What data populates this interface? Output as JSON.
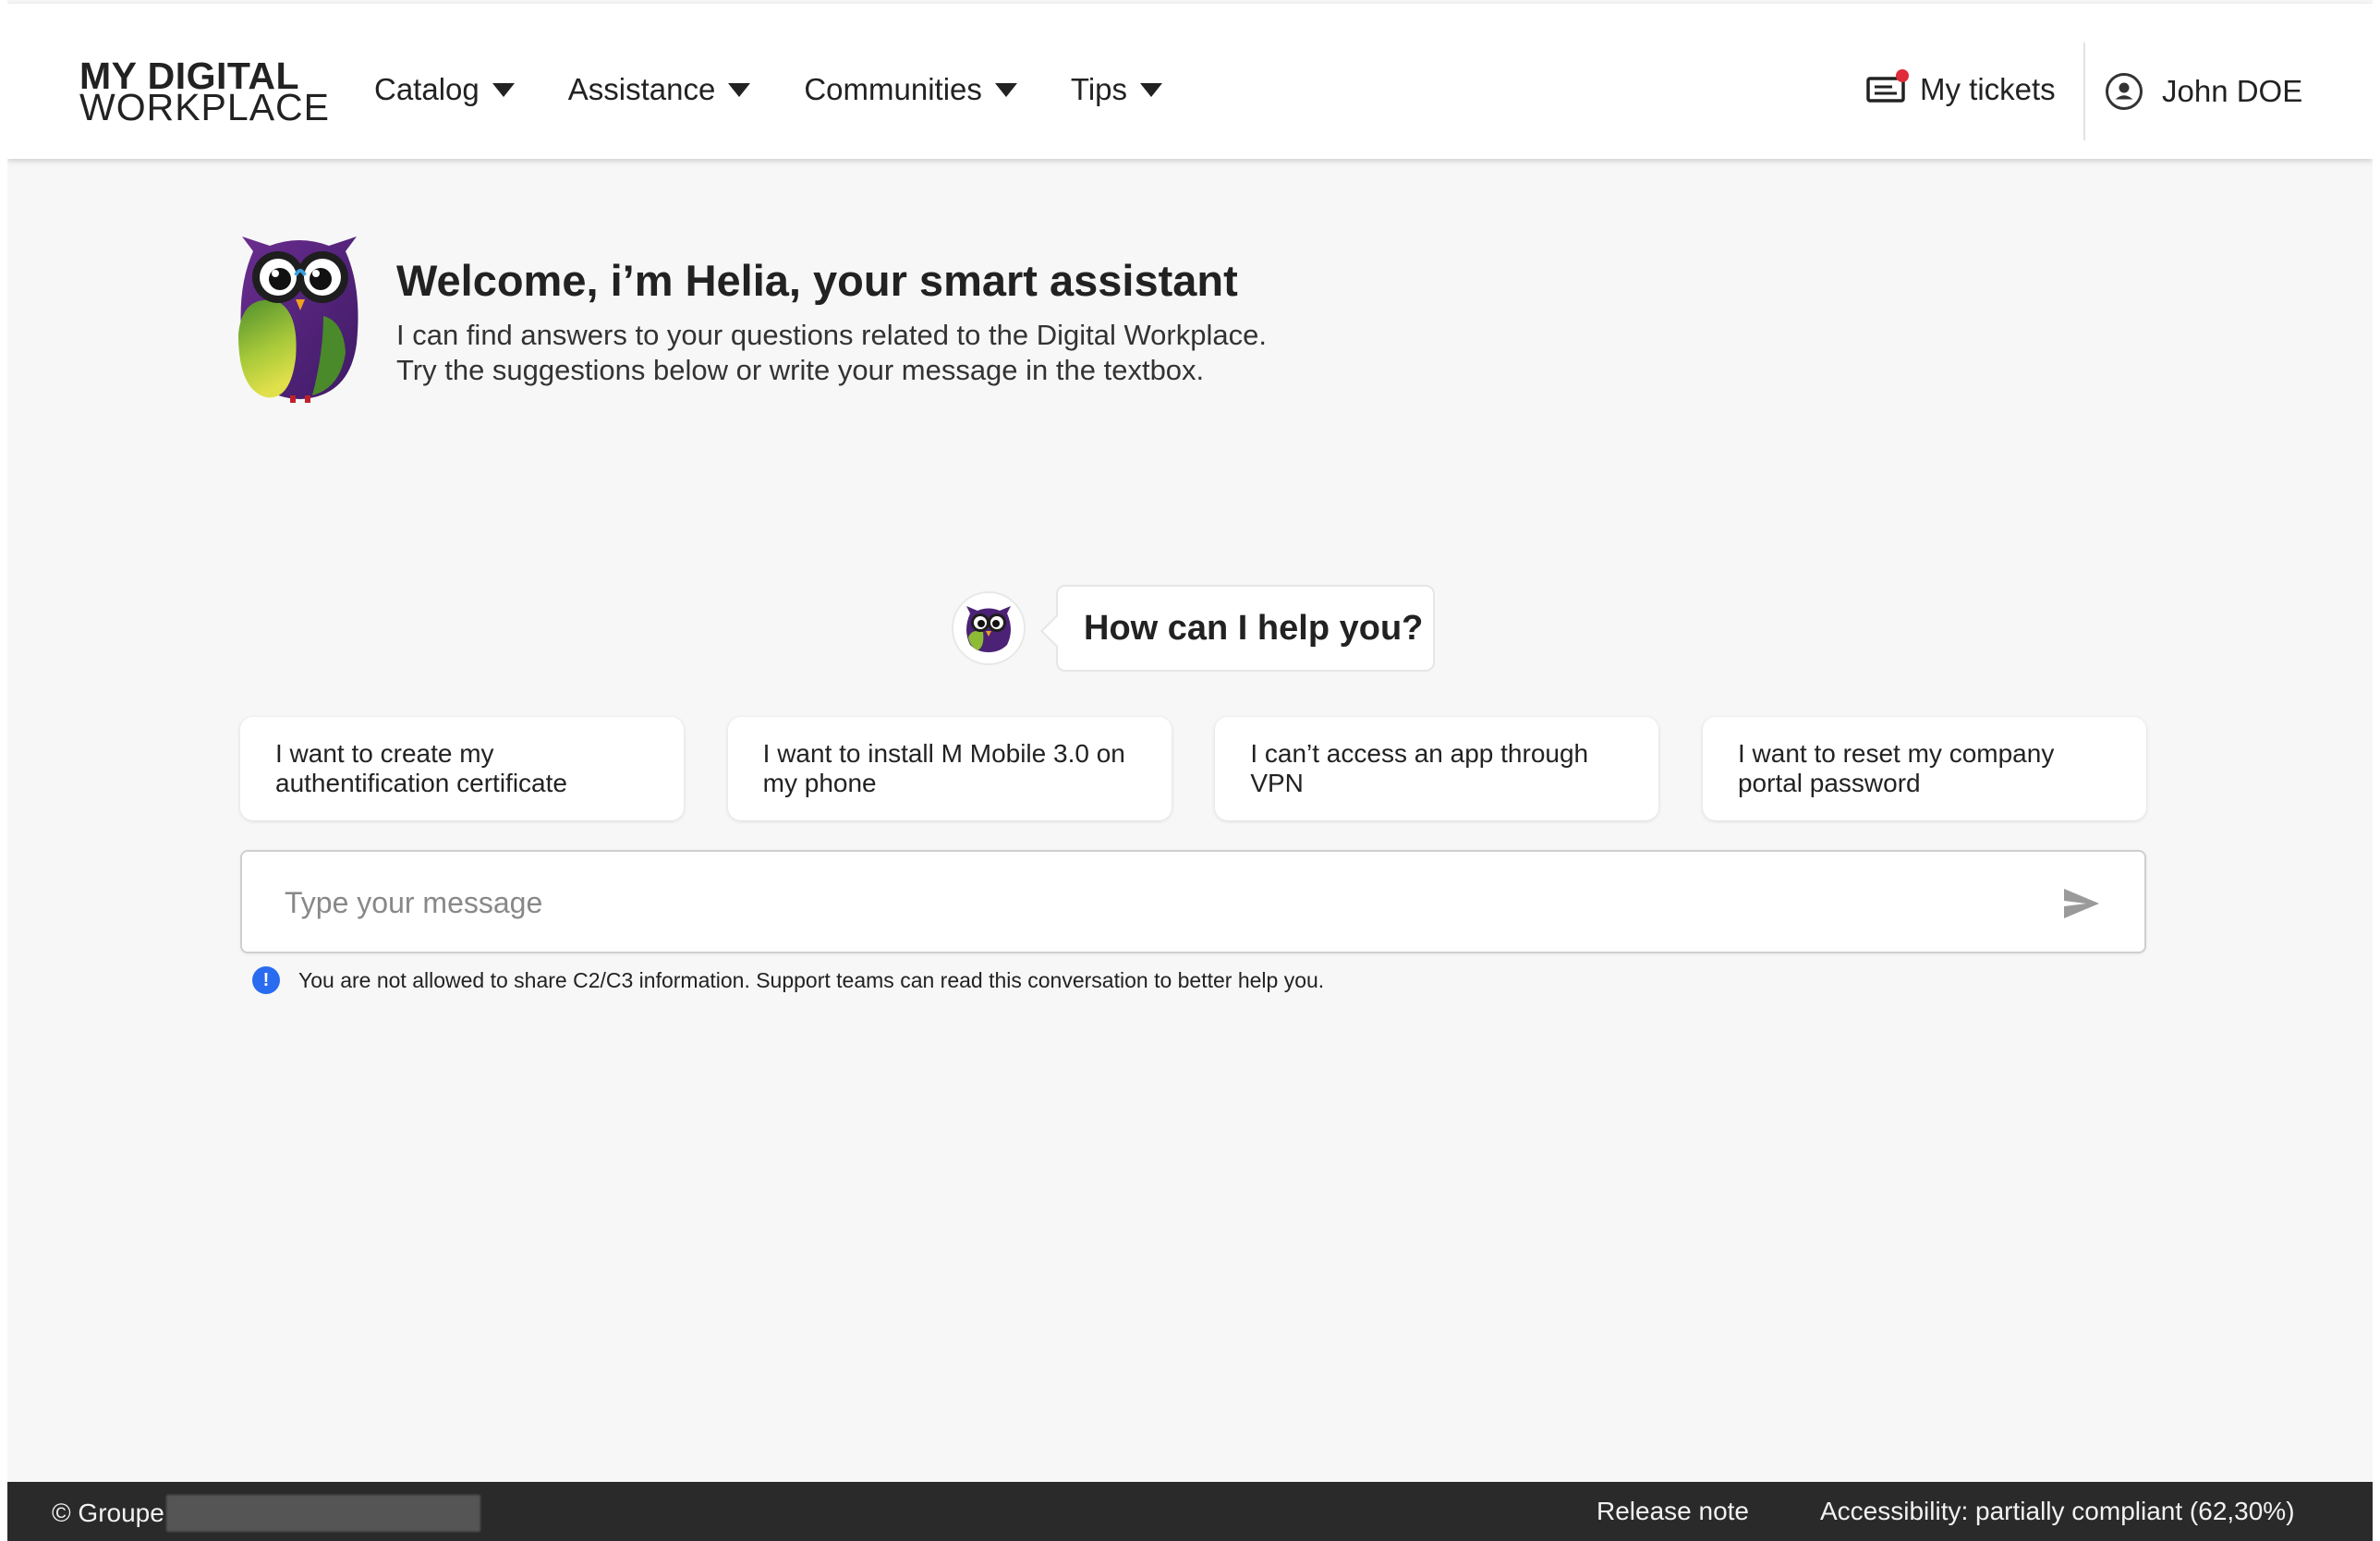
{
  "header": {
    "logo_line1": "MY DIGITAL",
    "logo_line2": "WORKPLACE",
    "nav": [
      {
        "label": "Catalog",
        "icon": "caret-down-icon"
      },
      {
        "label": "Assistance",
        "icon": "caret-down-icon"
      },
      {
        "label": "Communities",
        "icon": "caret-down-icon"
      },
      {
        "label": "Tips",
        "icon": "caret-down-icon"
      }
    ],
    "tickets_label": "My tickets",
    "tickets_icon": "ticket-icon",
    "notification_color": "#e02b3a",
    "user_name": "John DOE",
    "user_icon": "user-circle-icon"
  },
  "welcome": {
    "title": "Welcome, i’m Helia, your smart assistant",
    "line1": "I can find answers to your questions related to the Digital Workplace.",
    "line2": "Try the suggestions below or write your message in the textbox."
  },
  "chat": {
    "prompt": "How can I help you?",
    "suggestions": [
      {
        "label": "I want to create my authentification certificate"
      },
      {
        "label": "I want to install M Mobile 3.0 on my phone"
      },
      {
        "label": "I can’t access an app through VPN"
      },
      {
        "label": "I want to reset my company portal password"
      }
    ],
    "input_placeholder": "Type your message",
    "input_value": "",
    "send_icon": "send-icon",
    "notice_icon": "info-icon",
    "notice_icon_glyph": "!",
    "notice_color": "#2a6cf0",
    "notice": "You are not allowed to share C2/C3 information. Support teams can read this conversation to better help you."
  },
  "footer": {
    "copyright": "© Groupe",
    "release_note": "Release note",
    "accessibility": "Accessibility: partially compliant (62,30%)"
  }
}
